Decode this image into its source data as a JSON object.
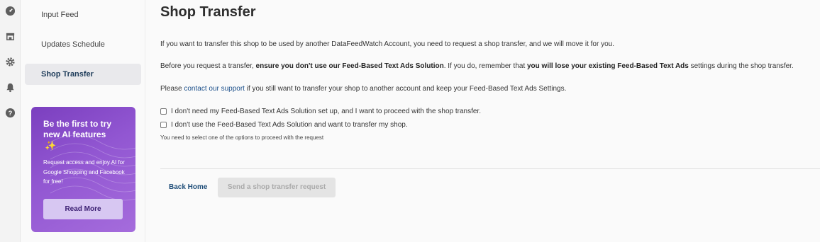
{
  "icons": [
    "speedometer-icon",
    "shop-icon",
    "gear-icon",
    "bell-icon",
    "help-icon"
  ],
  "sidebar": {
    "items": [
      {
        "label": "Input Feed"
      },
      {
        "label": "Updates Schedule"
      },
      {
        "label": "Shop Transfer"
      }
    ],
    "promo": {
      "title": "Be the first to try new AI features",
      "icon": "sparkles-icon",
      "description": "Request access and enjoy AI for Google Shopping and Facebook for free!",
      "button": "Read More"
    }
  },
  "main": {
    "title": "Shop Transfer",
    "p1": "If you want to transfer this shop to be used by another DataFeedWatch Account, you need to request a shop transfer, and we will move it for you.",
    "p2": {
      "a": "Before you request a transfer, ",
      "b": "ensure you don't use our Feed-Based Text Ads Solution",
      "c": ". If you do, remember that ",
      "d": "you will lose your existing Feed-Based Text Ads",
      "e": " settings during the shop transfer."
    },
    "p3": {
      "a": "Please ",
      "link": "contact our support",
      "b": " if you still want to transfer your shop to another account and keep your Feed-Based Text Ads Settings."
    },
    "options": [
      {
        "label": "I don't need my Feed-Based Text Ads Solution set up, and I want to proceed with the shop transfer.",
        "checked": false
      },
      {
        "label": "I don't use the Feed-Based Text Ads Solution and want to transfer my shop.",
        "checked": false
      }
    ],
    "hint": "You need to select one of the options to proceed with the request",
    "back_label": "Back Home",
    "send_label": "Send a shop transfer request"
  },
  "colors": {
    "accent": "#1f4e79",
    "promo_gradient_start": "#7b3fbf",
    "promo_gradient_end": "#a56cdc",
    "disabled_button": "#e4e4e4"
  }
}
